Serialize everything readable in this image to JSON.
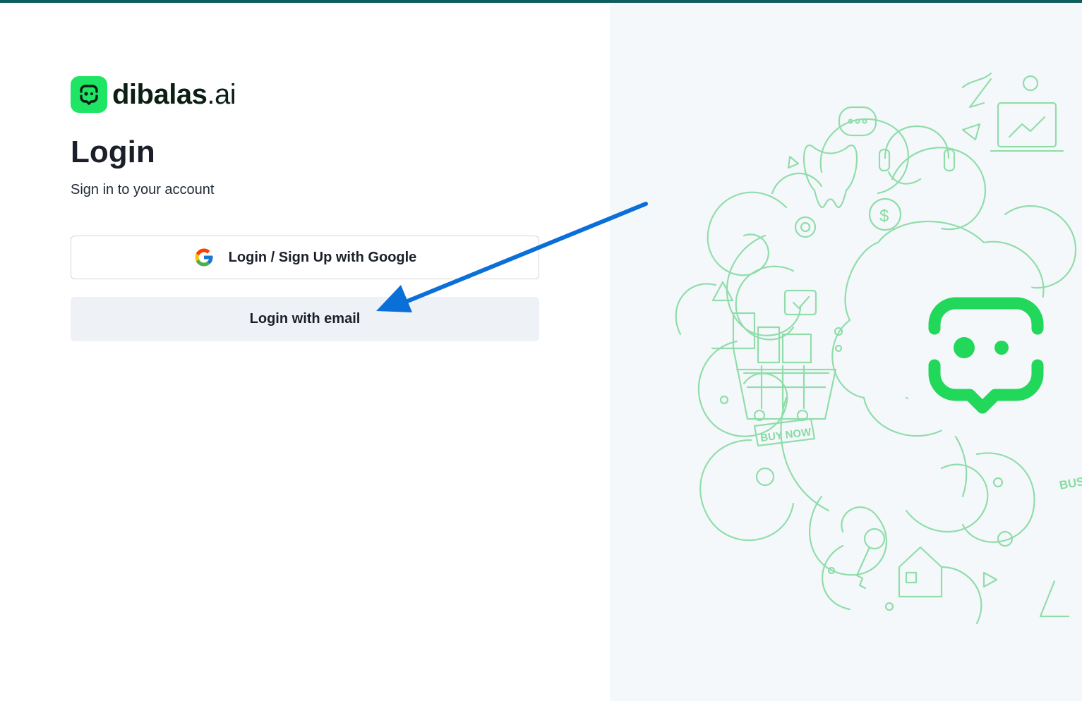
{
  "brand": {
    "name_main": "dibalas",
    "name_tld": ".ai",
    "color": "#1ee664"
  },
  "login": {
    "title": "Login",
    "subtitle": "Sign in to your account",
    "google_button_label": "Login / Sign Up with Google",
    "email_button_label": "Login with email"
  },
  "illustration": {
    "buy_now_label": "BUY NOW",
    "bus_label": "BUS",
    "dollar_label": "$",
    "accent_color": "#7fd99d"
  },
  "annotation": {
    "arrow_color": "#0b6fd8"
  }
}
